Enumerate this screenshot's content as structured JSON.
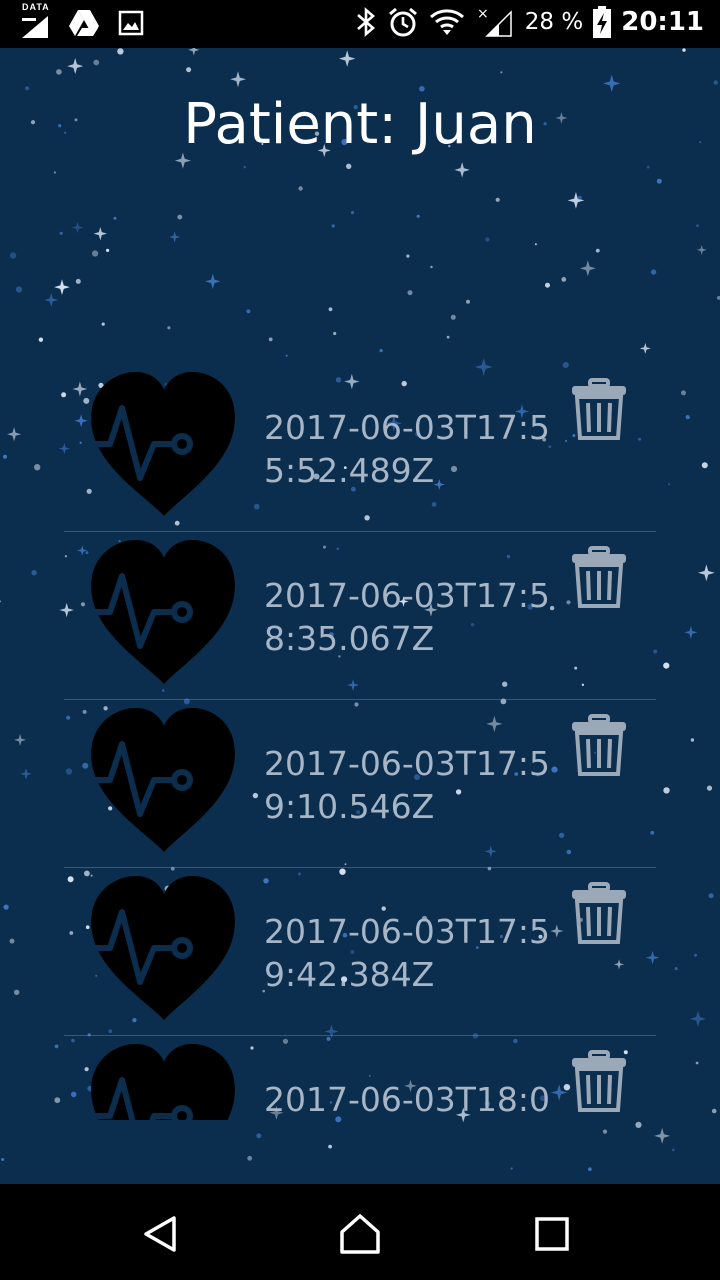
{
  "status_bar": {
    "data_label": "DATA",
    "battery_percent": "28 %",
    "clock": "20:11",
    "icons": [
      "data-icon",
      "drive-icon",
      "image-icon",
      "bluetooth-icon",
      "alarm-icon",
      "wifi-icon",
      "signal-icon",
      "battery-charging-icon"
    ]
  },
  "header": {
    "title": "Patient: Juan"
  },
  "records": [
    {
      "timestamp": "2017-06-03T17:55:52.489Z"
    },
    {
      "timestamp": "2017-06-03T17:58:35.067Z"
    },
    {
      "timestamp": "2017-06-03T17:59:10.546Z"
    },
    {
      "timestamp": "2017-06-03T17:59:42.384Z"
    },
    {
      "timestamp": "2017-06-03T18:0"
    }
  ],
  "nav_bar": {
    "icons": [
      "back-icon",
      "home-icon",
      "recents-icon"
    ]
  },
  "colors": {
    "background": "#0b2d4e",
    "timestamp_text": "#a7b6c6",
    "trash_icon": "#9aa8b8"
  }
}
